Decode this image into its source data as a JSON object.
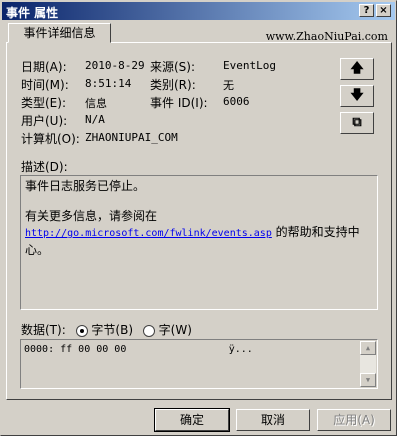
{
  "window": {
    "title": "事件 属性",
    "help_btn": "?",
    "close_btn": "×"
  },
  "tab": {
    "label": "事件详细信息"
  },
  "brand": "www.ZhaoNiuPai.com",
  "fields": {
    "date_label": "日期(A):",
    "date_value": "2010-8-29",
    "source_label": "来源(S):",
    "source_value": "EventLog",
    "time_label": "时间(M):",
    "time_value": "8:51:14",
    "category_label": "类别(R):",
    "category_value": "无",
    "type_label": "类型(E):",
    "type_value": "信息",
    "event_id_label": "事件 ID(I):",
    "event_id_value": "6006",
    "user_label": "用户(U):",
    "user_value": "N/A",
    "computer_label": "计算机(O):",
    "computer_value": "ZHAONIUPAI_COM"
  },
  "side_buttons": {
    "up": "🡅",
    "down": "🡇",
    "copy": "⧉"
  },
  "description": {
    "label": "描述(D):",
    "line1": "事件日志服务已停止。",
    "line2": "有关更多信息，请参阅在",
    "link": "http://go.microsoft.com/fwlink/events.asp",
    "line3": " 的帮助和支持中心。"
  },
  "data": {
    "label": "数据(T):",
    "bytes_label": "字节(B)",
    "words_label": "字(W)",
    "selected": "bytes",
    "content": "0000: ff 00 00 00                 ÿ..."
  },
  "buttons": {
    "ok": "确定",
    "cancel": "取消",
    "apply": "应用(A)"
  }
}
